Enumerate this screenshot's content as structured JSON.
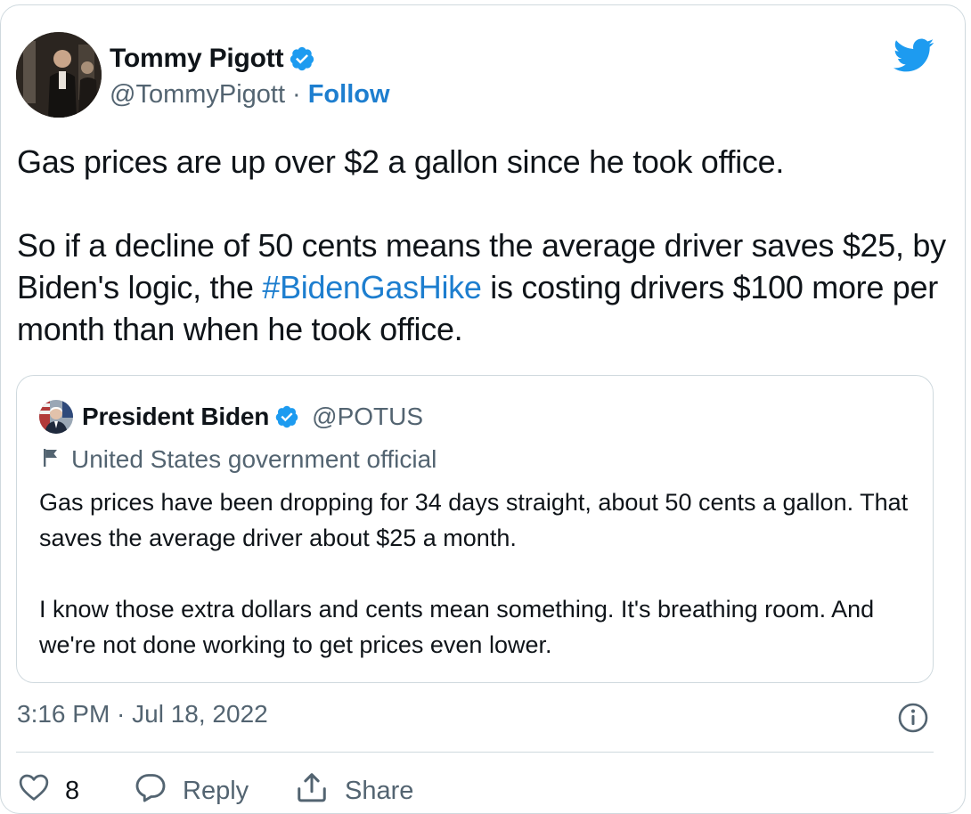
{
  "author": {
    "name": "Tommy Pigott",
    "handle": "@TommyPigott",
    "separator": "·",
    "follow_label": "Follow"
  },
  "tweet": {
    "text_part1": "Gas prices are up over $2 a gallon since he took office.\n\nSo if a decline of 50 cents means the average driver saves $25, by Biden's logic, the ",
    "hashtag": "#BidenGasHike",
    "text_part2": " is costing drivers $100 more per month than when he took office."
  },
  "quoted": {
    "name": "President Biden",
    "handle": "@POTUS",
    "gov_label": "United States government official",
    "text": "Gas prices have been dropping for 34 days straight, about 50 cents a gallon. That saves the average driver about $25 a month.\n\nI know those extra dollars and cents mean something. It's breathing room. And we're not done working to get prices even lower."
  },
  "timestamp": "3:16 PM · Jul 18, 2022",
  "actions": {
    "like_count": "8",
    "reply_label": "Reply",
    "share_label": "Share"
  },
  "colors": {
    "accent": "#1d9bf0",
    "link": "#1d7ecf",
    "secondary_text": "#536471",
    "border": "#cfd9de"
  },
  "icons": [
    "verified-badge-icon",
    "twitter-bird-icon",
    "flag-icon",
    "info-icon",
    "heart-icon",
    "reply-bubble-icon",
    "share-icon"
  ]
}
